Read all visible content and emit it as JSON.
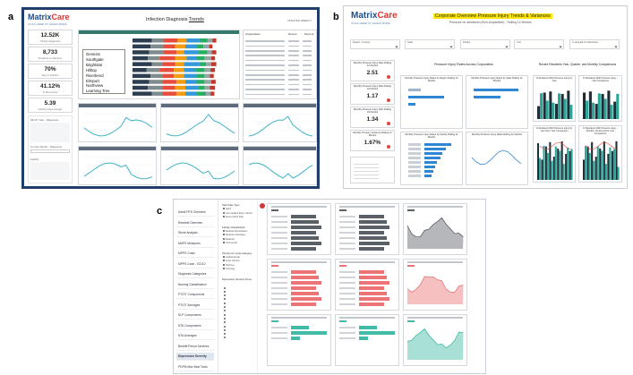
{
  "labels": {
    "a": "a",
    "b": "b",
    "c": "c"
  },
  "brand": {
    "name_part1": "Matrix",
    "name_part2": "Care",
    "tagline": "CLICK HERE TO LEARN MORE"
  },
  "panel_a": {
    "title_prefix": "Infection Diagnosis",
    "title_underlined": "Trends",
    "corner_note": "UPDATED WEEKLY",
    "kpis": [
      {
        "value": "12.52K",
        "label": "Infection Diagnoses"
      },
      {
        "value": "8,733",
        "label": "Residents w/ Infections"
      },
      {
        "value": "70%",
        "label": "Stay w/ Infection"
      },
      {
        "value": "41.12%",
        "label": "% Recurrence"
      },
      {
        "value": "5.39",
        "label": "Infection Days Average"
      }
    ],
    "legend_items": [
      "Genesis",
      "Southgate",
      "Brightstar",
      "Hilltop",
      "Riverbend",
      "Elmport",
      "Northview",
      "Learning Tree"
    ],
    "filters": [
      "Month Year - Diagnosis",
      "Current Month - Diagnosis",
      "Facility"
    ],
    "table_header": [
      "Organization",
      "Recent",
      "Percent"
    ]
  },
  "panel_b": {
    "title": "Corporate Overview Pressure Injury Trends & Variances",
    "subtitle": "Pressure on admission (Non-Acquisition) - Rolling 12 Months",
    "filters": [
      "Region / Country",
      "State",
      "Facility",
      "Unit",
      "In Hospital On Admission"
    ],
    "kpis": [
      {
        "value": "2.51",
        "label": "Monthly Pressure Injury Rate Rolling 12 Months"
      },
      {
        "value": "1.17",
        "label": "Monthly Pressure Injury Rate Rolling 12 Months"
      },
      {
        "value": "1.34",
        "label": "Monthly Pressure Injury Rate Rolling 12 Months"
      },
      {
        "value": "1.67%",
        "label": "Monthly PI Injury Incidence Rolling 12 Months"
      }
    ],
    "center_heading": "Pressure Injury Rates Across Corporation",
    "right_heading": "Recent Residents Year, Quarter, and Monthly Comparisons",
    "card_titles": [
      "Monthly Pressure Injury Rates by Region Rolling 12 Months",
      "Monthly Pressure Injury Rates by State Rolling 12 Months",
      "Monthly Pressure Injury Rates by Facility Rolling 12 Months",
      "Monthly Pressure Injury Rates Rolling 12 Months"
    ],
    "right_card_titles": [
      "% Residents With Pressure Injury by Year",
      "% Residents With Pressure Injury - Year Comparison",
      "% Residents With Pressure Injury by Year Over Year Comparison",
      "% Residents With Pressure Injury - Monthly Trends & Prior Year Comparison"
    ],
    "bar_colors": {
      "blue": "#2f86d4",
      "dark": "#1f2d36",
      "teal": "#2aa79b",
      "green": "#17877a"
    }
  },
  "panel_c": {
    "nav_items": [
      "Admit PPS Overview",
      "Readmit Overview",
      "Stone Analysis",
      "MAPS Measures",
      "MPPS Costs",
      "MPPS Code - ICD10",
      "Diagnosis Categories",
      "Nursing Classification",
      "PT/OT Components",
      "PT/OT Averages",
      "SLP Components",
      "NTA Components",
      "NTA Averages",
      "Benefit Period Services",
      "Depression Severity",
      "PDPM Max Best Tools"
    ],
    "active_nav": "Depression Severity",
    "filter_headings": [
      "Start Date Type",
      "Facility Classification",
      "Primary Dx Code Category",
      "Depression Severity Score"
    ],
    "filter_options": [
      "Admit",
      "Last Updated Date in Month",
      "Recent Admit Date",
      "Medicare Beneficiaries",
      "Medicare Advantage",
      "Medicaid",
      "Commercial",
      "Cardiovascular",
      "Acute Infection",
      "Hip/Knee",
      "Oncology"
    ],
    "row_colors": [
      "#5a6068",
      "#ec7476",
      "#41bba5"
    ]
  }
}
